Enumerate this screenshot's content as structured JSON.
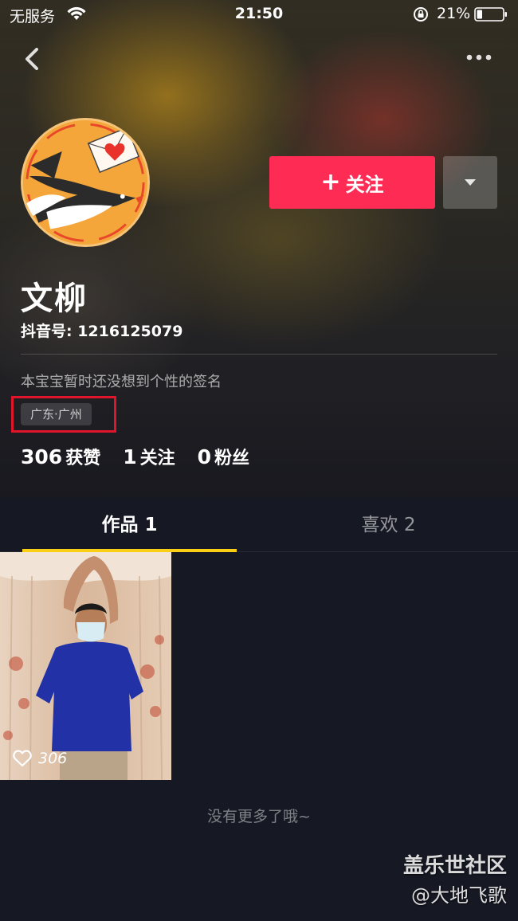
{
  "status_bar": {
    "carrier": "无服务",
    "time": "21:50",
    "battery": "21%",
    "battery_level": 0.21,
    "icons": [
      "wifi-icon",
      "rotation-lock-icon",
      "battery-icon"
    ]
  },
  "nav": {
    "back_icon": "chevron-left-icon",
    "more_icon": "ellipsis-icon"
  },
  "profile": {
    "avatar": "avatar-swallow-heart-letter",
    "name": "文柳",
    "douyin_id": "抖音号: 1216125079",
    "signature": "本宝宝暂时还没想到个性的签名",
    "location": "广东·广州"
  },
  "actions": {
    "follow_plus": "+",
    "follow_label": "关注",
    "dropdown_icon": "triangle-down-icon"
  },
  "stats": [
    {
      "value": "306",
      "label": "获赞"
    },
    {
      "value": "1",
      "label": "关注"
    },
    {
      "value": "0",
      "label": "粉丝"
    }
  ],
  "tabs": [
    {
      "label": "作品 1",
      "active": true
    },
    {
      "label": "喜欢 2",
      "active": false
    }
  ],
  "videos": [
    {
      "likes": "306"
    }
  ],
  "footer": {
    "no_more": "没有更多了哦~"
  },
  "watermark": {
    "title": "盖乐世社区",
    "user": "@大地飞歌"
  },
  "colors": {
    "accent_red": "#fe2c55",
    "tab_indicator": "#face15",
    "background": "#161823",
    "highlight_box": "#e0142a"
  }
}
